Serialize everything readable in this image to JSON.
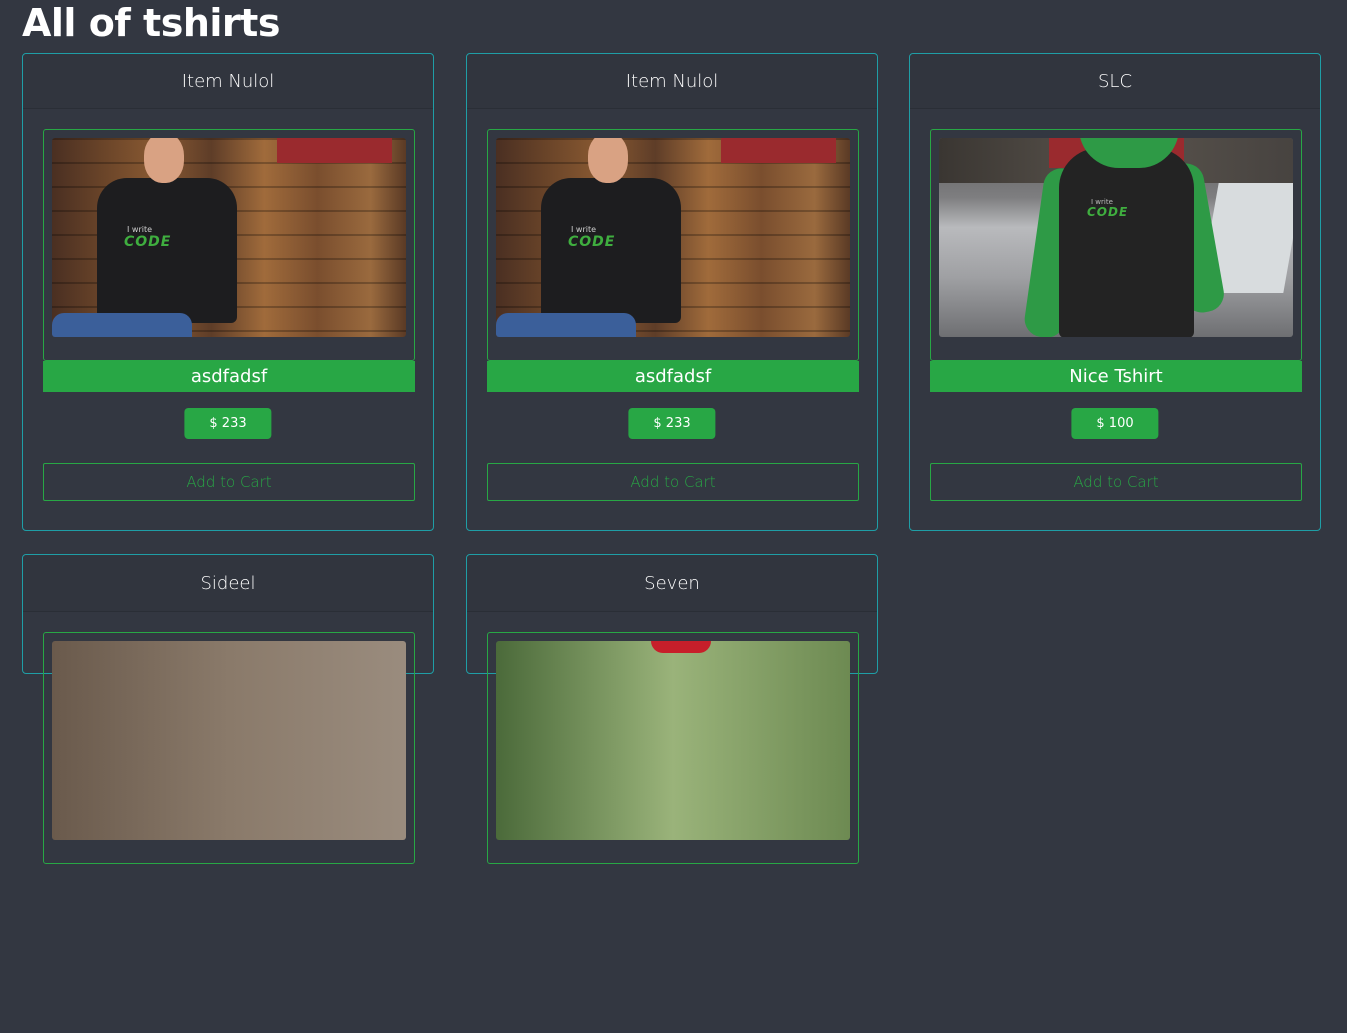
{
  "page": {
    "title": "All of tshirts"
  },
  "products": [
    {
      "title": "Item Nulol",
      "name": "asdfadsf",
      "price": "$ 233",
      "button": "Add to Cart",
      "image": "man-in-black-code-tshirt-wood-wall",
      "shirt_text_small": "I write",
      "shirt_text_big": "CODE"
    },
    {
      "title": "Item Nulol",
      "name": "asdfadsf",
      "price": "$ 233",
      "button": "Add to Cart",
      "image": "man-in-black-code-tshirt-wood-wall",
      "shirt_text_small": "I write",
      "shirt_text_big": "CODE"
    },
    {
      "title": "SLC",
      "name": "Nice Tshirt",
      "price": "$ 100",
      "button": "Add to Cart",
      "image": "woman-in-green-hoodie-by-car",
      "shirt_text_small": "I write",
      "shirt_text_big": "CODE"
    },
    {
      "title": "Sideel",
      "image": "partial-photo"
    },
    {
      "title": "Seven",
      "image": "partial-photo-red-cap"
    }
  ],
  "colors": {
    "background": "#333741",
    "card_border": "#1f9ea6",
    "accent_green": "#28a745"
  }
}
